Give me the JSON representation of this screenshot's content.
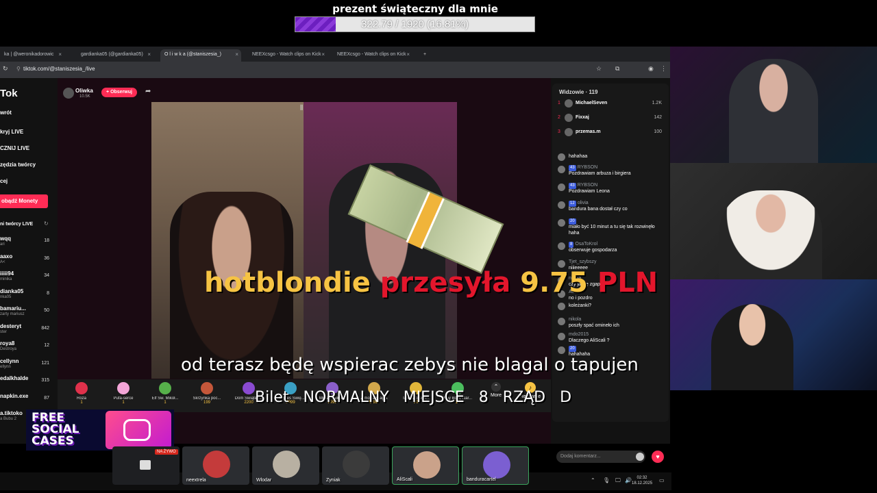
{
  "goal": {
    "title": "prezent świąteczny dla mnie",
    "progress_text": "322.79 / 1920 (16.81%)",
    "progress_fraction": 0.1681
  },
  "browser": {
    "tabs": [
      "ka | @weronikadorowic",
      "gardianka05 (@gardianka05)",
      "O l i w k a (@staniszesia_)",
      "NEEXcsgo - Watch clips on Kick",
      "NEEXcsgo - Watch clips on Kick"
    ],
    "url": "tiktok.com/@staniszesia_/live"
  },
  "tiktok": {
    "logo": "Tok",
    "nav": [
      "wrót",
      "kryj LIVE",
      "CZNIJ LIVE",
      "zędzia twórcy",
      "cej"
    ],
    "coins_button": "obądź Monety",
    "creators_header": "ni twórcy LIVE",
    "creators": [
      {
        "name": "wqq",
        "sub": "ari",
        "count": "18"
      },
      {
        "name": "aaxo",
        "sub": "A<",
        "count": "36"
      },
      {
        "name": "iiiii94",
        "sub": "minika",
        "count": "34"
      },
      {
        "name": "dianka05",
        "sub": "nka05",
        "count": "8"
      },
      {
        "name": "bamariu...",
        "sub": "zarty mariusz",
        "count": "50"
      },
      {
        "name": "desteryt",
        "sub": "ster",
        "count": "842"
      },
      {
        "name": "roya8",
        "sub": "Destroya",
        "count": "12"
      },
      {
        "name": "cellynn",
        "sub": "ellynn",
        "count": "121"
      },
      {
        "name": "edalkhalde",
        "sub": "",
        "count": "315"
      },
      {
        "name": "napkin.exe",
        "sub": "",
        "count": "87"
      },
      {
        "name": "a.tiktoko",
        "sub": "a Bubu 2",
        "count": ""
      }
    ],
    "host": {
      "name": "Oliwka",
      "followers": "10.5K",
      "follow_label": "+ Obserwuj"
    }
  },
  "alert": {
    "user": "hotblondie",
    "verb": "przesyła",
    "amount": "9.75",
    "currency": "PLN",
    "message": "od terasz będę wspierac zebys nie blagal o tapujen",
    "ticket": "Bilet NORMALNY MIEJSCE 8 RZĄD D"
  },
  "gifts": [
    {
      "name": "Róża",
      "price": "1"
    },
    {
      "name": "Pufa-serce",
      "price": "1"
    },
    {
      "name": "Elf Św. Mikoł...",
      "price": "1"
    },
    {
      "name": "Skrzynka poc...",
      "price": "199"
    },
    {
      "name": "Dom Świąteg...",
      "price": "2200"
    },
    {
      "name": "Ekspres Świę...",
      "price": "5999"
    },
    {
      "name": "Miasto Mikoł...",
      "price": "9999"
    },
    {
      "name": "Zimowa magia",
      "price": "19999"
    },
    {
      "name": "Tater Boże N...",
      "price": "10"
    },
    {
      "name": "Tiny Boże Nar...",
      "price": "10"
    }
  ],
  "gift_more": "More",
  "gift_recharge": "Recharge",
  "viewers": {
    "title": "Widzowie · 119",
    "top": [
      {
        "rank": "1",
        "name": "MichaelSeven",
        "count": "1.2K"
      },
      {
        "rank": "2",
        "name": "Fixxaj",
        "count": "142"
      },
      {
        "rank": "3",
        "name": "przemas.m",
        "count": "100"
      }
    ],
    "chat": [
      {
        "user": "",
        "badge": "",
        "msg": "hahahaa"
      },
      {
        "user": "RYBSON",
        "badge": "43",
        "msg": "Pozdrawiam arbuza i birgiera"
      },
      {
        "user": "RYBSON",
        "badge": "43",
        "msg": "Pozdrawiam Leona"
      },
      {
        "user": "olivia",
        "badge": "12",
        "msg": "bandura bana dostał czy co"
      },
      {
        "user": "",
        "badge": "20",
        "msg": "miało być 10 minut a tu się tak rozwinęło haha"
      },
      {
        "user": "OsaToKrol",
        "badge": "8",
        "msg": "obserwuje gospodarza"
      },
      {
        "user": "Tjet_szybszy",
        "badge": "",
        "msg": "niiieeeee"
      },
      {
        "user": "nikola",
        "badge": "",
        "msg": "czy ja się zgapiłem"
      },
      {
        "user": "Adrian",
        "badge": "",
        "msg": "no i pozdro"
      },
      {
        "user": "",
        "badge": "",
        "msg": "koleżanki?"
      },
      {
        "user": "nikola",
        "badge": "",
        "msg": "poszły spać omineło ich"
      },
      {
        "user": "mdo2015",
        "badge": "",
        "msg": "Dlaczego AliScali ?"
      },
      {
        "user": "",
        "badge": "20",
        "msg": "hahahaha"
      }
    ],
    "comment_placeholder": "Dodaj komentarz..."
  },
  "taskbar": {
    "time": "02:32",
    "date": "18.12.2025"
  },
  "social_cases": {
    "line1": "FREE",
    "line2": "SOCIAL",
    "line3": "CASES"
  },
  "discord": {
    "tiles": [
      {
        "name": "neextrela"
      },
      {
        "name": "Wlodar"
      },
      {
        "name": "Zyniak"
      },
      {
        "name": "AliScali"
      },
      {
        "name": "banduracartel"
      }
    ],
    "live_badge": "NA ŻYWO"
  },
  "colors": {
    "accent": "#fe2c55",
    "goal_fill": "#7b2fcc",
    "alert_user": "#f6c343",
    "alert_verb": "#e3162c"
  }
}
